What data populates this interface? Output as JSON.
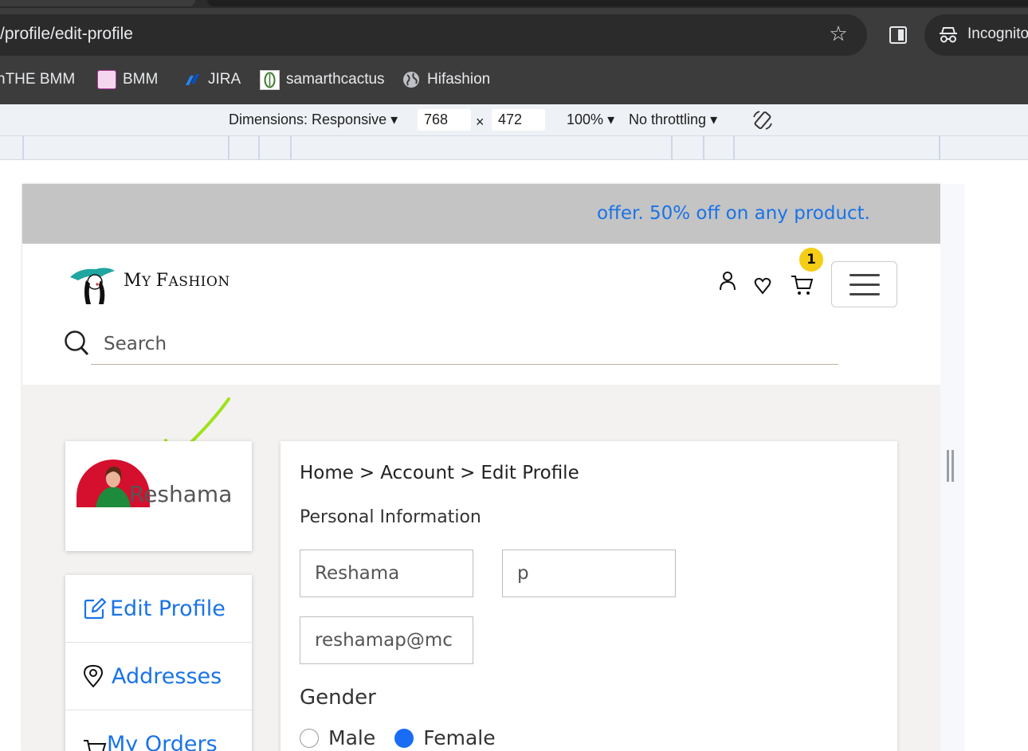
{
  "browser": {
    "url": "/profile/edit-profile",
    "incognito_label": "Incognito",
    "bookmarks": [
      {
        "label": "nTHE BMM"
      },
      {
        "label": "BMM"
      },
      {
        "label": "JIRA"
      },
      {
        "label": "samarthcactus"
      },
      {
        "label": "Hifashion"
      }
    ]
  },
  "devtools": {
    "dimensions_label": "Dimensions: Responsive",
    "width": "768",
    "times": "×",
    "height": "472",
    "zoom": "100%",
    "throttling": "No throttling"
  },
  "site": {
    "announcement": "offer. 50% off on any product.",
    "brand_first": "M",
    "brand_rest1": "Y ",
    "brand_second": "F",
    "brand_rest2": "ASHION",
    "cart_count": "1",
    "search_placeholder": "Search"
  },
  "profile": {
    "name": "Reshama"
  },
  "menu": {
    "items": [
      {
        "label": "Edit Profile"
      },
      {
        "label": "Addresses"
      },
      {
        "label": "My Orders"
      }
    ]
  },
  "edit": {
    "breadcrumb": [
      "Home",
      "Account",
      "Edit Profile"
    ],
    "breadcrumb_sep": ">",
    "section_title": "Personal Information",
    "first_name": "Reshama",
    "last_name": "p",
    "email": "reshamap@mc",
    "gender_label": "Gender",
    "gender_options": [
      "Male",
      "Female"
    ],
    "gender_selected": "Female"
  },
  "colors": {
    "link_blue": "#1a73e8",
    "badge_yellow": "#f5cd15",
    "arrow_green": "#9ee21c"
  }
}
